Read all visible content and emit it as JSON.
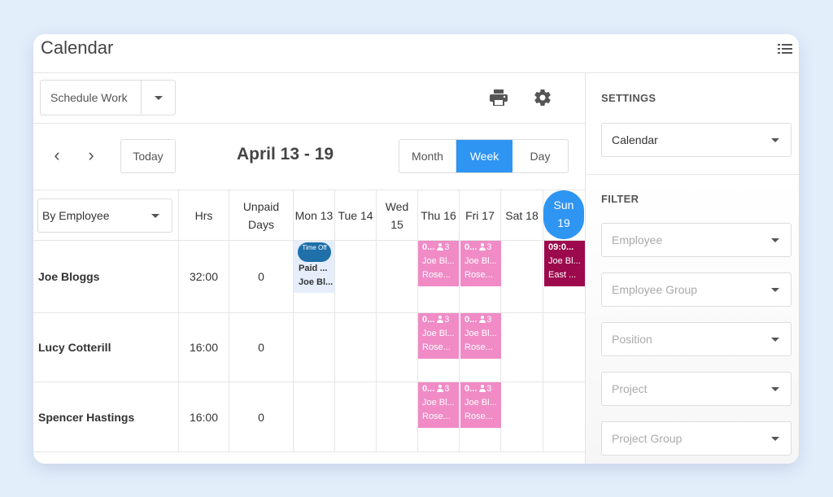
{
  "app": {
    "title": "Calendar"
  },
  "toolbar": {
    "schedule_work_label": "Schedule Work",
    "print_icon": "print-icon",
    "settings_icon": "gear-icon"
  },
  "nav": {
    "prev_icon": "chevron-left-icon",
    "next_icon": "chevron-right-icon",
    "prev_glyph": "‹",
    "next_glyph": "›",
    "today_label": "Today",
    "range_title": "April 13 - 19",
    "views": [
      {
        "label": "Month",
        "active": false
      },
      {
        "label": "Week",
        "active": true
      },
      {
        "label": "Day",
        "active": false
      }
    ]
  },
  "grid": {
    "group_by_label": "By Employee",
    "headers": {
      "hrs": "Hrs",
      "unpaid": "Unpaid Days"
    },
    "days": [
      {
        "label": "Mon 13"
      },
      {
        "label": "Tue 14"
      },
      {
        "label": "Wed 15"
      },
      {
        "label": "Thu 16"
      },
      {
        "label": "Fri 17"
      },
      {
        "label": "Sat 18"
      },
      {
        "label": "Sun 19",
        "today": true
      }
    ],
    "rows": [
      {
        "name": "Joe Bloggs",
        "hrs": "32:00",
        "unpaid": "0",
        "time_off": {
          "badge": "Time Off",
          "line1": "Paid ...",
          "line2": "Joe Bl..."
        },
        "shifts": [
          {
            "day": 3,
            "time": "0...",
            "count": "3",
            "person": "Joe Bl...",
            "location": "Rose..."
          },
          {
            "day": 4,
            "time": "0...",
            "count": "3",
            "person": "Joe Bl...",
            "location": "Rose..."
          },
          {
            "day": 6,
            "time": "09:0...",
            "person": "Joe Bl...",
            "location": "East ...",
            "dark": true
          }
        ]
      },
      {
        "name": "Lucy Cotterill",
        "hrs": "16:00",
        "unpaid": "0",
        "shifts": [
          {
            "day": 3,
            "time": "0...",
            "count": "3",
            "person": "Joe Bl...",
            "location": "Rose..."
          },
          {
            "day": 4,
            "time": "0...",
            "count": "3",
            "person": "Joe Bl...",
            "location": "Rose..."
          }
        ]
      },
      {
        "name": "Spencer Hastings",
        "hrs": "16:00",
        "unpaid": "0",
        "shifts": [
          {
            "day": 3,
            "time": "0...",
            "count": "3",
            "person": "Joe Bl...",
            "location": "Rose..."
          },
          {
            "day": 4,
            "time": "0...",
            "count": "3",
            "person": "Joe Bl...",
            "location": "Rose..."
          }
        ]
      }
    ]
  },
  "sidebar": {
    "settings_heading": "SETTINGS",
    "settings_value": "Calendar",
    "filter_heading": "FILTER",
    "filters": [
      {
        "placeholder": "Employee"
      },
      {
        "placeholder": "Employee Group"
      },
      {
        "placeholder": "Position"
      },
      {
        "placeholder": "Project"
      },
      {
        "placeholder": "Project Group"
      }
    ]
  },
  "colors": {
    "accent": "#2f95f3",
    "shift": "#f08bc6",
    "shift_dark": "#9c0a4d",
    "time_off_badge": "#1f6fa9",
    "time_off_bg": "#e6eefb"
  }
}
